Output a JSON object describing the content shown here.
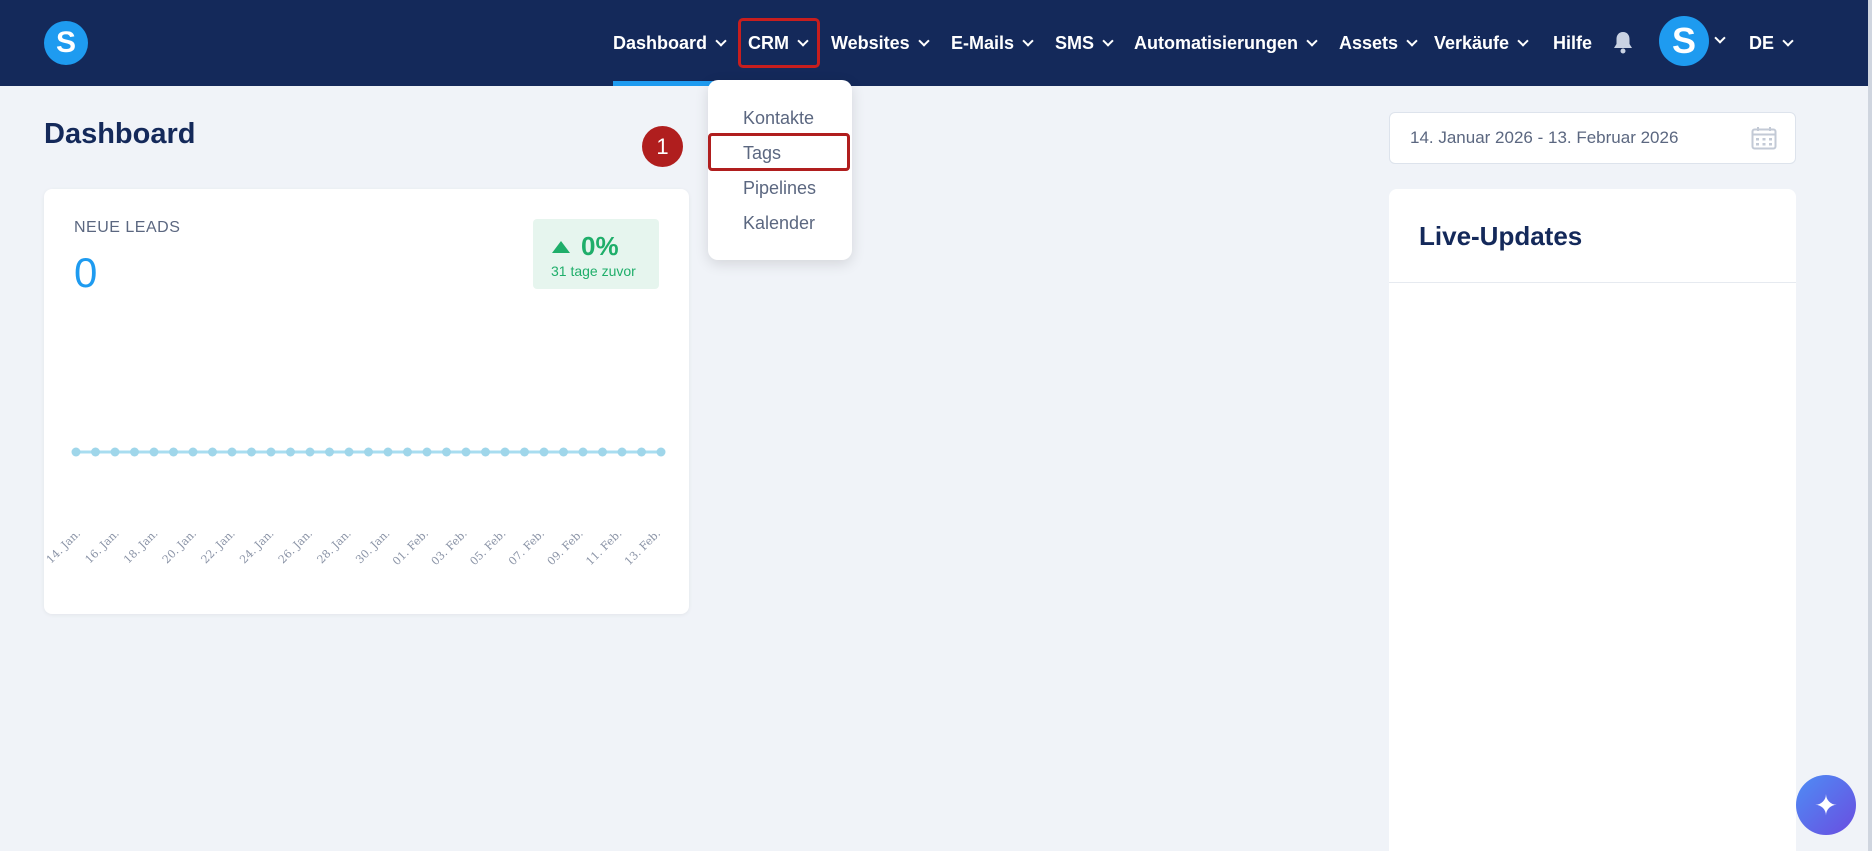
{
  "brand": {
    "logo_letter": "S"
  },
  "nav": {
    "items": [
      {
        "label": "Dashboard",
        "has_dropdown": true,
        "active": true
      },
      {
        "label": "CRM",
        "has_dropdown": true,
        "highlighted": true
      },
      {
        "label": "Websites",
        "has_dropdown": true
      },
      {
        "label": "E-Mails",
        "has_dropdown": true
      },
      {
        "label": "SMS",
        "has_dropdown": true
      },
      {
        "label": "Automatisierungen",
        "has_dropdown": true
      },
      {
        "label": "Assets",
        "has_dropdown": true
      },
      {
        "label": "Verkäufe",
        "has_dropdown": true
      },
      {
        "label": "Hilfe",
        "has_dropdown": false
      }
    ],
    "bell_icon": "bell-icon",
    "avatar_letter": "S",
    "language": "DE"
  },
  "crm_menu": {
    "items": [
      "Kontakte",
      "Tags",
      "Pipelines",
      "Kalender"
    ],
    "highlighted_item": "Tags",
    "step_badge": "1"
  },
  "page": {
    "title": "Dashboard"
  },
  "date_range": {
    "value": "14. Januar 2026 - 13. Februar 2026",
    "icon": "calendar-icon"
  },
  "leads_card": {
    "label": "NEUE LEADS",
    "value": "0",
    "change_pct": "0%",
    "change_sub": "31 tage zuvor",
    "change_direction": "up"
  },
  "chart_data": {
    "type": "line",
    "x_ticks": [
      "14. Jan.",
      "16. Jan.",
      "18. Jan.",
      "20. Jan.",
      "22. Jan.",
      "24. Jan.",
      "26. Jan.",
      "28. Jan.",
      "30. Jan.",
      "01. Feb.",
      "03. Feb.",
      "05. Feb.",
      "07. Feb.",
      "09. Feb.",
      "11. Feb.",
      "13. Feb."
    ],
    "point_count": 31,
    "values": [
      0,
      0,
      0,
      0,
      0,
      0,
      0,
      0,
      0,
      0,
      0,
      0,
      0,
      0,
      0,
      0,
      0,
      0,
      0,
      0,
      0,
      0,
      0,
      0,
      0,
      0,
      0,
      0,
      0,
      0,
      0
    ],
    "line_color": "#a8ddf0",
    "point_color": "#9fd6ea"
  },
  "live_updates": {
    "title": "Live-Updates"
  },
  "fab": {
    "icon": "sparkle-icon",
    "glyph": "✦"
  }
}
